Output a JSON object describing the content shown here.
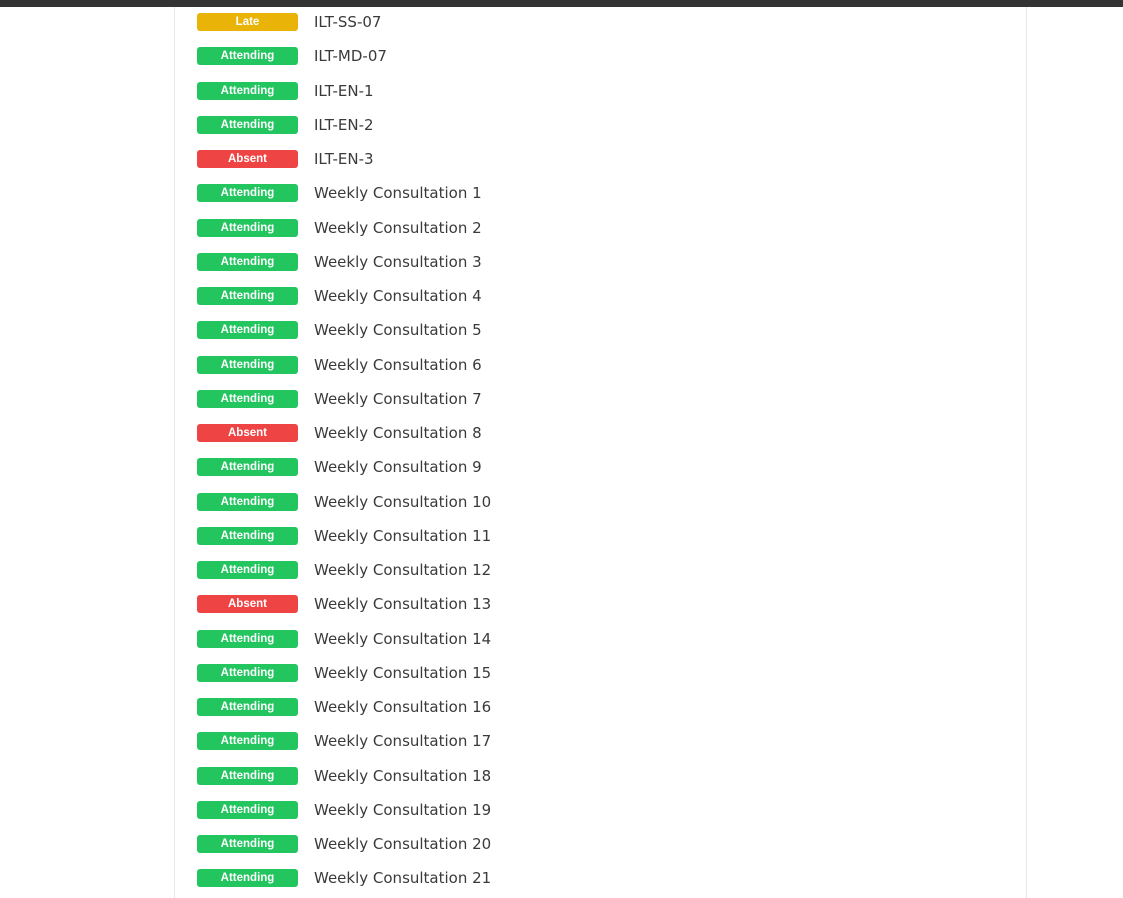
{
  "status_colors": {
    "Attending": "#22c55e",
    "Absent": "#ef4444",
    "Late": "#eab308"
  },
  "sessions": [
    {
      "status": "Late",
      "name": "ILT-SS-07"
    },
    {
      "status": "Attending",
      "name": "ILT-MD-07"
    },
    {
      "status": "Attending",
      "name": "ILT-EN-1"
    },
    {
      "status": "Attending",
      "name": "ILT-EN-2"
    },
    {
      "status": "Absent",
      "name": "ILT-EN-3"
    },
    {
      "status": "Attending",
      "name": "Weekly Consultation 1"
    },
    {
      "status": "Attending",
      "name": "Weekly Consultation 2"
    },
    {
      "status": "Attending",
      "name": "Weekly Consultation 3"
    },
    {
      "status": "Attending",
      "name": "Weekly Consultation 4"
    },
    {
      "status": "Attending",
      "name": "Weekly Consultation 5"
    },
    {
      "status": "Attending",
      "name": "Weekly Consultation 6"
    },
    {
      "status": "Attending",
      "name": "Weekly Consultation 7"
    },
    {
      "status": "Absent",
      "name": "Weekly Consultation 8"
    },
    {
      "status": "Attending",
      "name": "Weekly Consultation 9"
    },
    {
      "status": "Attending",
      "name": "Weekly Consultation 10"
    },
    {
      "status": "Attending",
      "name": "Weekly Consultation 11"
    },
    {
      "status": "Attending",
      "name": "Weekly Consultation 12"
    },
    {
      "status": "Absent",
      "name": "Weekly Consultation 13"
    },
    {
      "status": "Attending",
      "name": "Weekly Consultation 14"
    },
    {
      "status": "Attending",
      "name": "Weekly Consultation 15"
    },
    {
      "status": "Attending",
      "name": "Weekly Consultation 16"
    },
    {
      "status": "Attending",
      "name": "Weekly Consultation 17"
    },
    {
      "status": "Attending",
      "name": "Weekly Consultation 18"
    },
    {
      "status": "Attending",
      "name": "Weekly Consultation 19"
    },
    {
      "status": "Attending",
      "name": "Weekly Consultation 20"
    },
    {
      "status": "Attending",
      "name": "Weekly Consultation 21"
    }
  ]
}
